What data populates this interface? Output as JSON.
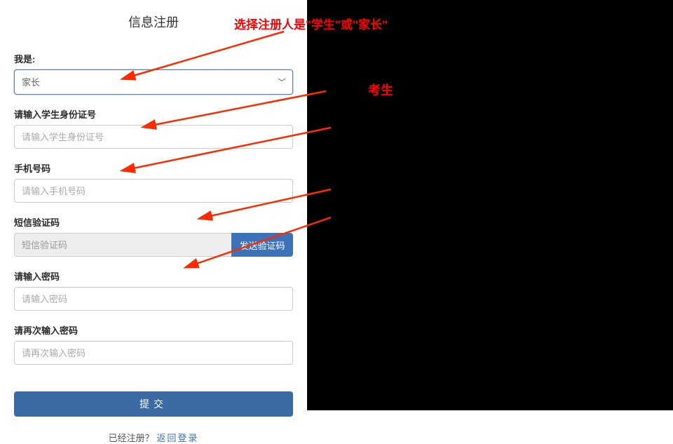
{
  "title": "信息注册",
  "form": {
    "iam": {
      "label": "我是:",
      "value": "家长"
    },
    "student_id": {
      "label": "请输入学生身份证号",
      "placeholder": "请输入学生身份证号"
    },
    "phone": {
      "label": "手机号码",
      "placeholder": "请输入手机号码"
    },
    "sms": {
      "label": "短信验证码",
      "placeholder": "短信验证码",
      "button": "发送验证码"
    },
    "password": {
      "label": "请输入密码",
      "placeholder": "请输入密码"
    },
    "password2": {
      "label": "请再次输入密码",
      "placeholder": "请再次输入密码"
    },
    "submit": "提交"
  },
  "footer": {
    "text": "已经注册？",
    "link": "返回登录"
  },
  "annotations": {
    "top": "选择注册人是\"学生\"或\"家长\"",
    "right": "考生"
  },
  "colors": {
    "accent": "#3c6aa5",
    "annotation": "#ff2a00"
  }
}
